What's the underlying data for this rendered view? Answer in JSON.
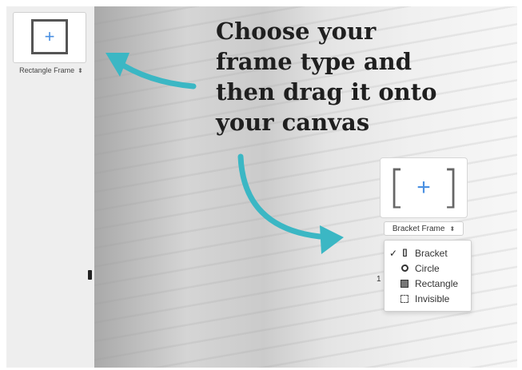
{
  "sidebar": {
    "frame_tile": {
      "icon": "rectangle-plus-icon",
      "plus_glyph": "+"
    },
    "frame_type_select": {
      "label": "Rectangle Frame",
      "updown_glyph": "⬍"
    }
  },
  "headline": {
    "lines": [
      "Choose your",
      "frame type and",
      "then drag it onto",
      "your canvas"
    ]
  },
  "bracket_tile": {
    "left_bracket": "[",
    "plus_glyph": "+",
    "right_bracket": "]"
  },
  "bracket_select": {
    "label": "Bracket Frame",
    "updown_glyph": "⬍"
  },
  "menu": {
    "items": [
      {
        "label": "Bracket",
        "checked": true,
        "check_glyph": "✓",
        "icon": "bracket-icon",
        "icon_glyph": "[]"
      },
      {
        "label": "Circle",
        "checked": false,
        "icon": "circle-icon"
      },
      {
        "label": "Rectangle",
        "checked": false,
        "icon": "rectangle-icon"
      },
      {
        "label": "Invisible",
        "checked": false,
        "icon": "invisible-icon"
      }
    ]
  },
  "colors": {
    "accent_arrow": "#3bb7c4",
    "plus_blue": "#4a90e2"
  },
  "side_tick": "1"
}
